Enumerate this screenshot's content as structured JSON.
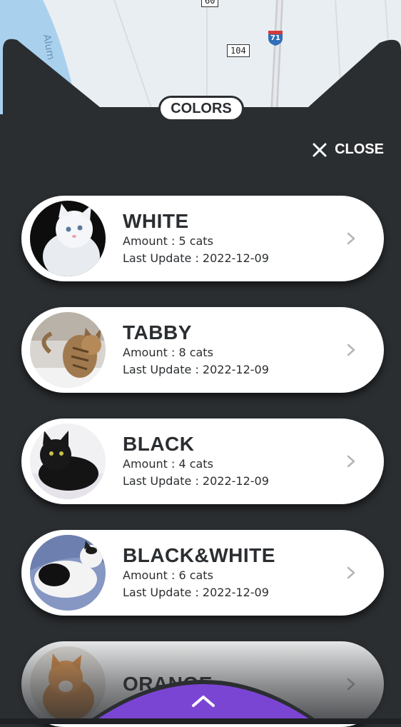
{
  "map": {
    "road_label_top": "60",
    "road_label_104": "104",
    "interstate_label": "71",
    "water_label": "Alum"
  },
  "panel": {
    "section_label": "COLORS",
    "close_label": "CLOSE"
  },
  "colors": [
    {
      "title": "WHITE",
      "amount": "Amount : 5 cats",
      "updated": "Last Update : 2022-12-09"
    },
    {
      "title": "TABBY",
      "amount": "Amount : 8 cats",
      "updated": "Last Update : 2022-12-09"
    },
    {
      "title": "BLACK",
      "amount": "Amount : 4 cats",
      "updated": "Last Update : 2022-12-09"
    },
    {
      "title": "BLACK&WHITE",
      "amount": "Amount : 6 cats",
      "updated": "Last Update : 2022-12-09"
    },
    {
      "title": "ORANGE",
      "amount": "",
      "updated": ""
    }
  ],
  "theme": {
    "panel_bg": "#2b2e31",
    "card_bg": "#ffffff",
    "accent": "#7b45d4"
  },
  "icons": [
    "close-icon",
    "chevron-right-icon",
    "chevron-up-icon"
  ]
}
